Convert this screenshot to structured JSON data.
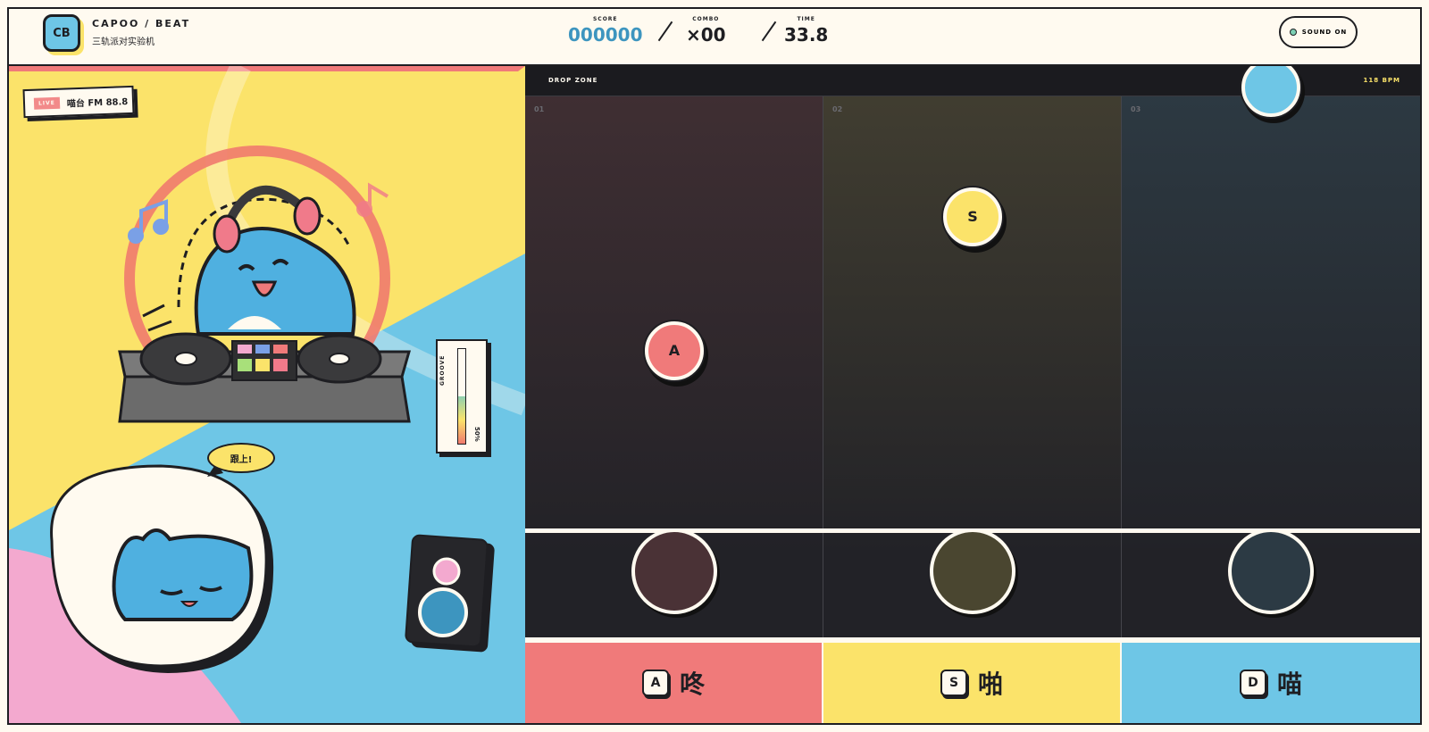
{
  "header": {
    "logo": "CB",
    "title": "CAPOO / BEAT",
    "subtitle": "三轨派对实验机",
    "stats": [
      {
        "label": "SCORE",
        "value": "000000"
      },
      {
        "label": "COMBO",
        "value": "×00"
      },
      {
        "label": "TIME",
        "value": "33.8"
      }
    ],
    "sound_button": "SOUND ON"
  },
  "scene": {
    "live_badge": "LIVE",
    "radio": "喵台 FM 88.8",
    "speech": "跟上!",
    "groove_label": "GROOVE",
    "groove_percent": "50%",
    "groove_level": 0.5
  },
  "board": {
    "zone_label": "DROP ZONE",
    "bpm": "118 BPM",
    "lanes": [
      {
        "num": "01",
        "color": "#f07a7a",
        "key": "A",
        "word": "咚"
      },
      {
        "num": "02",
        "color": "#fbe36a",
        "key": "S",
        "word": "啪"
      },
      {
        "num": "03",
        "color": "#6ec6e6",
        "key": "D",
        "word": "喵"
      }
    ],
    "notes": [
      {
        "lane": 0,
        "label": "A",
        "progress": 0.55
      },
      {
        "lane": 1,
        "label": "S",
        "progress": 0.26
      },
      {
        "lane": 2,
        "label": "",
        "progress": -0.02
      }
    ]
  },
  "colors": {
    "red": "#f07a7a",
    "yellow": "#fbe36a",
    "blue": "#6ec6e6",
    "pink": "#f3a9cf",
    "ink": "#1e1e22"
  }
}
